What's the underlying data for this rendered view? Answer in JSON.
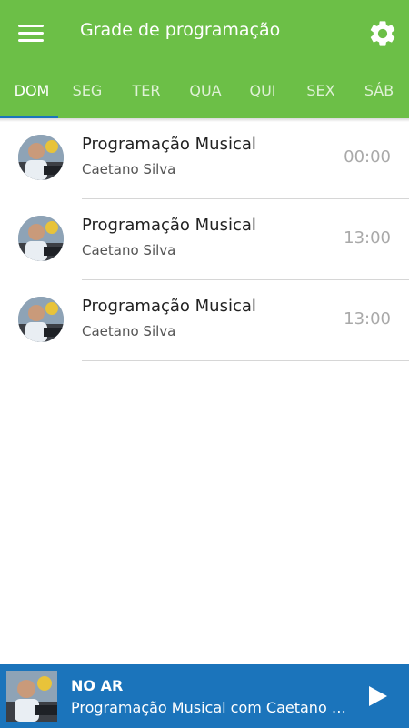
{
  "header": {
    "title": "Grade de programação",
    "menu_icon": "hamburger-menu-icon",
    "settings_icon": "gear-icon",
    "accent_color": "#6cbf47"
  },
  "tabs": [
    {
      "label": "DOM",
      "active": true
    },
    {
      "label": "SEG",
      "active": false
    },
    {
      "label": "TER",
      "active": false
    },
    {
      "label": "QUA",
      "active": false
    },
    {
      "label": "QUI",
      "active": false
    },
    {
      "label": "SEX",
      "active": false
    },
    {
      "label": "SÁB",
      "active": false
    }
  ],
  "schedule": [
    {
      "title": "Programação Musical",
      "host": "Caetano Silva",
      "time": "00:00",
      "time_highlight": true
    },
    {
      "title": "Programação Musical",
      "host": "Caetano Silva",
      "time": "13:00",
      "time_highlight": false
    },
    {
      "title": "Programação Musical",
      "host": "Caetano Silva",
      "time": "13:00",
      "time_highlight": false
    }
  ],
  "player": {
    "label": "NO AR",
    "now_playing": "Programação Musical com Caetano Silva",
    "play_icon": "play-icon",
    "background_color": "#1b74bb"
  }
}
